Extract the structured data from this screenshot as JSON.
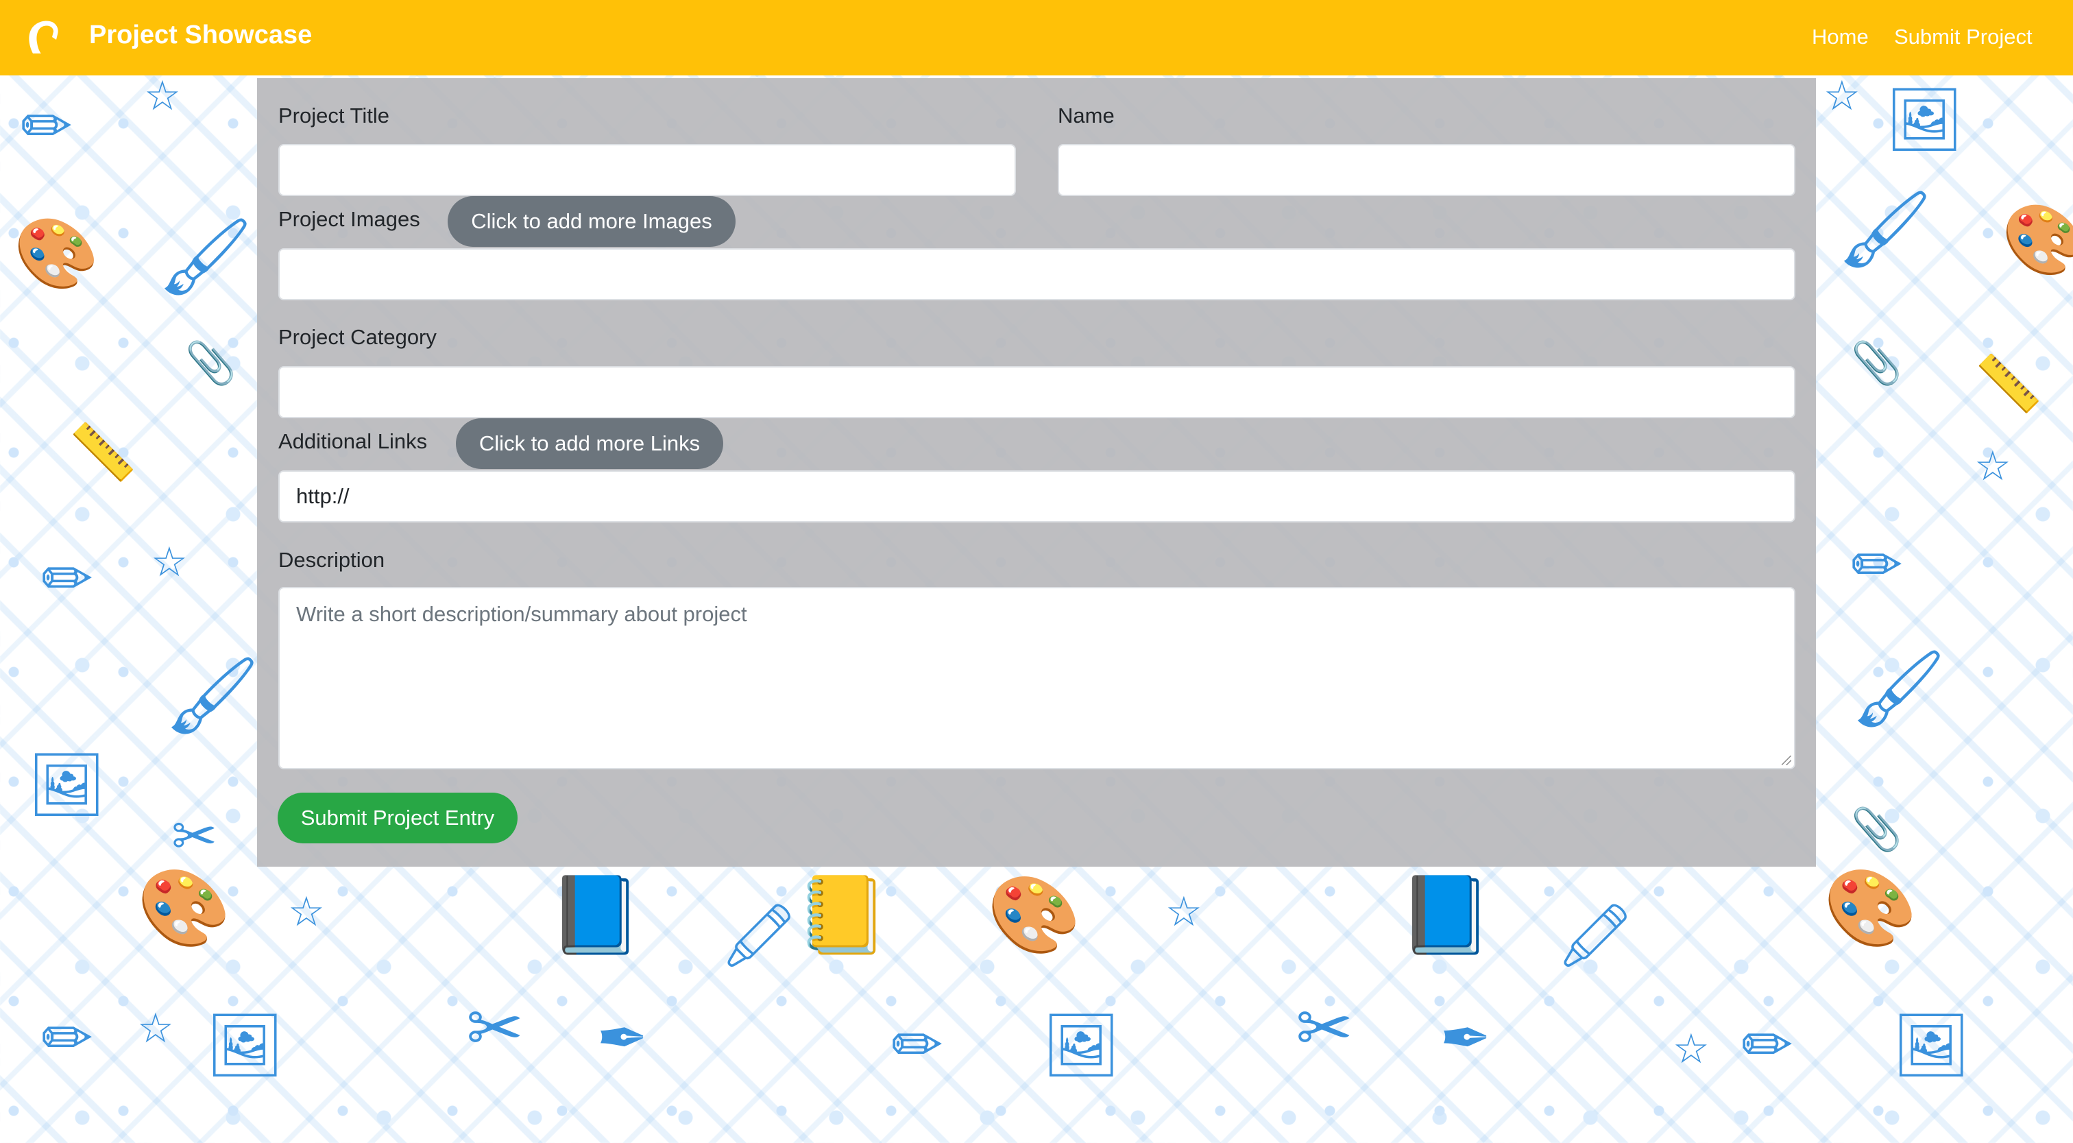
{
  "navbar": {
    "brand_title": "Project Showcase",
    "logo_icon": "horse-logo-icon",
    "links": [
      "Home",
      "Submit Project"
    ],
    "background_color": "#ffc107"
  },
  "form": {
    "project_title_label": "Project Title",
    "name_label": "Name",
    "project_images_label": "Project Images",
    "add_images_button": "Click to add more Images",
    "project_category_label": "Project Category",
    "additional_links_label": "Additional Links",
    "add_links_button": "Click to add more Links",
    "additional_links_value": "http://",
    "description_label": "Description",
    "description_placeholder": "Write a short description/summary about project",
    "submit_button": "Submit Project Entry",
    "submit_color": "#28a745",
    "secondary_button_color": "#6c757d"
  },
  "background": {
    "pattern": "art-supplies-doodle",
    "icon_color": "#3b92dd"
  }
}
